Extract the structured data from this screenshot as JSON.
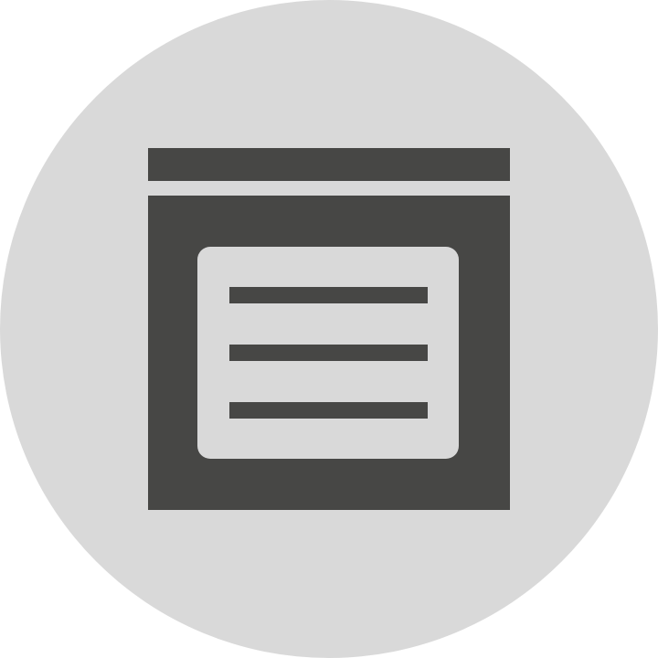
{
  "icon": {
    "name": "window-text-content-icon",
    "colors": {
      "background": "#d9d9d9",
      "foreground": "#474745"
    }
  }
}
